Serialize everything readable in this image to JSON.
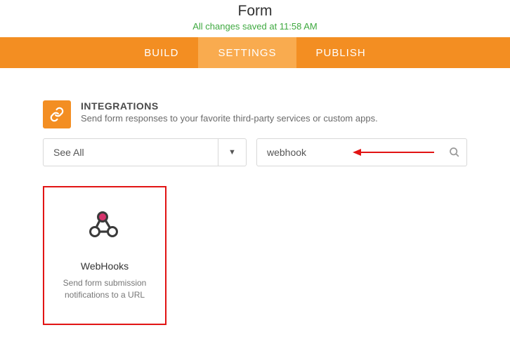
{
  "header": {
    "title": "Form",
    "save_status": "All changes saved at 11:58 AM"
  },
  "tabs": {
    "build": "BUILD",
    "settings": "SETTINGS",
    "publish": "PUBLISH"
  },
  "section": {
    "title": "INTEGRATIONS",
    "subtitle": "Send form responses to your favorite third-party services or custom apps."
  },
  "filter": {
    "label": "See All"
  },
  "search": {
    "value": "webhook",
    "placeholder": ""
  },
  "card": {
    "title": "WebHooks",
    "desc": "Send form submission notifications to a URL"
  }
}
